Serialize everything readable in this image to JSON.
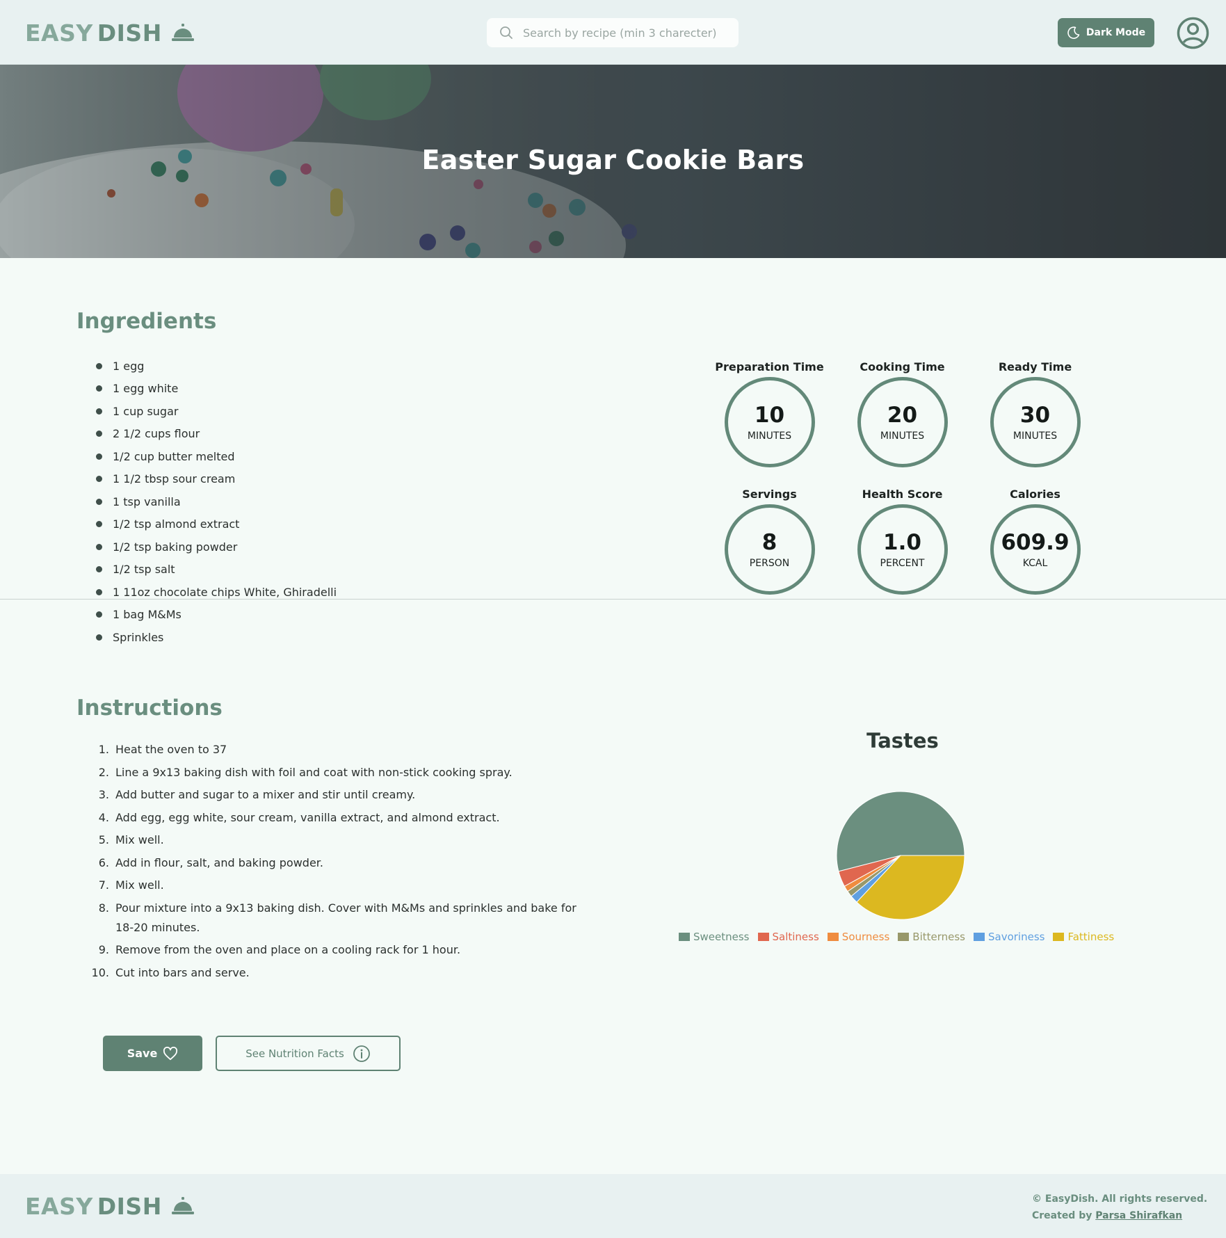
{
  "header": {
    "logo_part1": "EASY",
    "logo_part2": "DISH",
    "search_placeholder": "Search by recipe (min 3 charecter)",
    "dark_mode_label": "Dark Mode"
  },
  "hero": {
    "title": "Easter Sugar Cookie Bars"
  },
  "ingredients": {
    "title": "Ingredients",
    "items": [
      "1 egg",
      "1 egg white",
      "1 cup sugar",
      "2 1/2 cups flour",
      "1/2 cup butter melted",
      "1 1/2 tbsp sour cream",
      "1 tsp vanilla",
      "1/2 tsp almond extract",
      "1/2 tsp baking powder",
      "1/2 tsp salt",
      "1 11oz chocolate chips White, Ghiradelli",
      "1 bag M&Ms",
      "Sprinkles"
    ]
  },
  "stats": [
    {
      "label": "Preparation Time",
      "value": "10",
      "unit": "MINUTES"
    },
    {
      "label": "Cooking Time",
      "value": "20",
      "unit": "MINUTES"
    },
    {
      "label": "Ready Time",
      "value": "30",
      "unit": "MINUTES"
    },
    {
      "label": "Servings",
      "value": "8",
      "unit": "PERSON"
    },
    {
      "label": "Health Score",
      "value": "1.0",
      "unit": "PERCENT"
    },
    {
      "label": "Calories",
      "value": "609.9",
      "unit": "KCAL"
    }
  ],
  "instructions": {
    "title": "Instructions",
    "steps": [
      {
        "num": "1.",
        "text": "Heat the oven to 37"
      },
      {
        "num": "2.",
        "text": "Line a 9x13 baking dish with foil and coat with non-stick cooking spray."
      },
      {
        "num": "3.",
        "text": "Add butter and sugar to a mixer and stir until creamy."
      },
      {
        "num": "4.",
        "text": "Add egg, egg white, sour cream, vanilla extract, and almond extract."
      },
      {
        "num": "5.",
        "text": "Mix well."
      },
      {
        "num": "6.",
        "text": "Add in flour, salt, and baking powder."
      },
      {
        "num": "7.",
        "text": "Mix well."
      },
      {
        "num": "8.",
        "text": "Pour mixture into a 9x13 baking dish. Cover with M&Ms and sprinkles and bake for 18-20 minutes."
      },
      {
        "num": "9.",
        "text": "Remove from the oven and place on a cooling rack for 1 hour."
      },
      {
        "num": "10.",
        "text": "Cut into bars and serve."
      }
    ]
  },
  "chart_data": {
    "type": "pie",
    "title": "Tastes",
    "legend_position": "bottom",
    "series": [
      {
        "name": "Sweetness",
        "value": 54,
        "color": "#6b8f7f"
      },
      {
        "name": "Saltiness",
        "value": 4,
        "color": "#e0674f"
      },
      {
        "name": "Sourness",
        "value": 1.5,
        "color": "#ef8c3f"
      },
      {
        "name": "Bitterness",
        "value": 1.5,
        "color": "#98986a"
      },
      {
        "name": "Savoriness",
        "value": 2,
        "color": "#5f9fe0"
      },
      {
        "name": "Fattiness",
        "value": 37,
        "color": "#dcb820"
      }
    ]
  },
  "actions": {
    "save_label": "Save",
    "nutrition_label": "See Nutrition Facts"
  },
  "footer": {
    "copyright": "© EasyDish. All rights reserved.",
    "created_by": "Created by",
    "author": "Parsa Shirafkan"
  },
  "colors": {
    "accent": "#5f8273",
    "circle_border": "#638979",
    "page_bg": "#f4faf7",
    "header_bg": "#e8f1f1"
  }
}
